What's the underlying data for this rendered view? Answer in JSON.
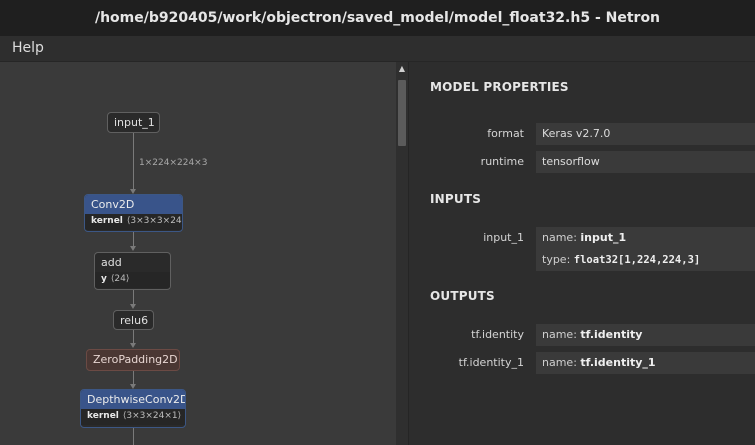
{
  "window": {
    "title": "/home/b920405/work/objectron/saved_model/model_float32.h5 - Netron"
  },
  "menu": {
    "help": "Help"
  },
  "graph": {
    "edge_input_label": "1×224×224×3",
    "nodes": {
      "input": {
        "label": "input_1"
      },
      "conv2d": {
        "label": "Conv2D",
        "attr_name": "kernel",
        "attr_value": "⟨3×3×3×24⟩"
      },
      "add": {
        "label": "add",
        "attr_name": "y",
        "attr_value": "⟨24⟩"
      },
      "relu6": {
        "label": "relu6"
      },
      "zeropadding": {
        "label": "ZeroPadding2D"
      },
      "depthwise": {
        "label": "DepthwiseConv2D",
        "attr_name": "kernel",
        "attr_value": "⟨3×3×24×1⟩"
      }
    }
  },
  "properties": {
    "model_title": "MODEL PROPERTIES",
    "format_label": "format",
    "format_value": "Keras v2.7.0",
    "runtime_label": "runtime",
    "runtime_value": "tensorflow",
    "inputs_title": "INPUTS",
    "input_name": "input_1",
    "input_name_key": "name:",
    "input_name_value": "input_1",
    "input_type_key": "type:",
    "input_type_value": "float32[1,224,224,3]",
    "outputs_title": "OUTPUTS",
    "output1_name": "tf.identity",
    "output1_key": "name:",
    "output1_value": "tf.identity",
    "output2_name": "tf.identity_1",
    "output2_key": "name:",
    "output2_value": "tf.identity_1"
  },
  "colors": {
    "conv_header": "#39548a",
    "pad_node": "#4a3733",
    "graph_background": "#3a3a3a"
  }
}
